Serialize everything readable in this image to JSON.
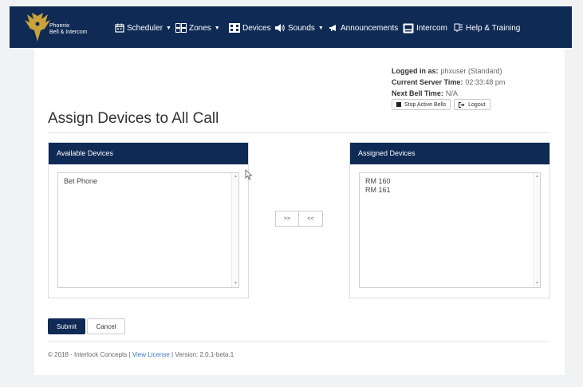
{
  "navbar": {
    "brand": {
      "line1": "Phoenix",
      "line2": "Bell & Intercom",
      "icon": "phoenix-logo"
    },
    "items": [
      {
        "label": "Scheduler",
        "icon": "calendar-icon",
        "has_caret": true
      },
      {
        "label": "Zones",
        "icon": "zones-icon",
        "has_caret": true
      },
      {
        "label": "Devices",
        "icon": "devices-icon",
        "has_caret": false
      },
      {
        "label": "Sounds",
        "icon": "speaker-icon",
        "has_caret": true
      },
      {
        "label": "Announcements",
        "icon": "megaphone-icon",
        "has_caret": false
      },
      {
        "label": "Intercom",
        "icon": "intercom-icon",
        "has_caret": false
      },
      {
        "label": "Help & Training",
        "icon": "help-icon",
        "has_caret": false
      }
    ]
  },
  "user_info": {
    "logged_in_label": "Logged in as:",
    "logged_in_value": "phxuser (Standard)",
    "server_time_label": "Current Server Time:",
    "server_time_value": "02:33:48 pm",
    "next_bell_label": "Next Bell Time:",
    "next_bell_value": "N/A",
    "stop_bells_label": "Stop Active Bells",
    "logout_label": "Logout"
  },
  "page": {
    "title": "Assign Devices to All Call"
  },
  "available": {
    "header": "Available Devices",
    "items": [
      "Bet Phone"
    ]
  },
  "assigned": {
    "header": "Assigned Devices",
    "items": [
      "RM 160",
      "RM 161"
    ]
  },
  "move": {
    "add_label": ">>",
    "remove_label": "<<"
  },
  "form": {
    "submit_label": "Submit",
    "cancel_label": "Cancel"
  },
  "footer": {
    "copyright": "© 2018 · Interlock Concepts |",
    "license_link": "View License",
    "version": "| Version: 2.0.1-beta.1"
  },
  "colors": {
    "navy": "#0f2a54",
    "gold": "#c9a23a",
    "link": "#3a75c4"
  }
}
